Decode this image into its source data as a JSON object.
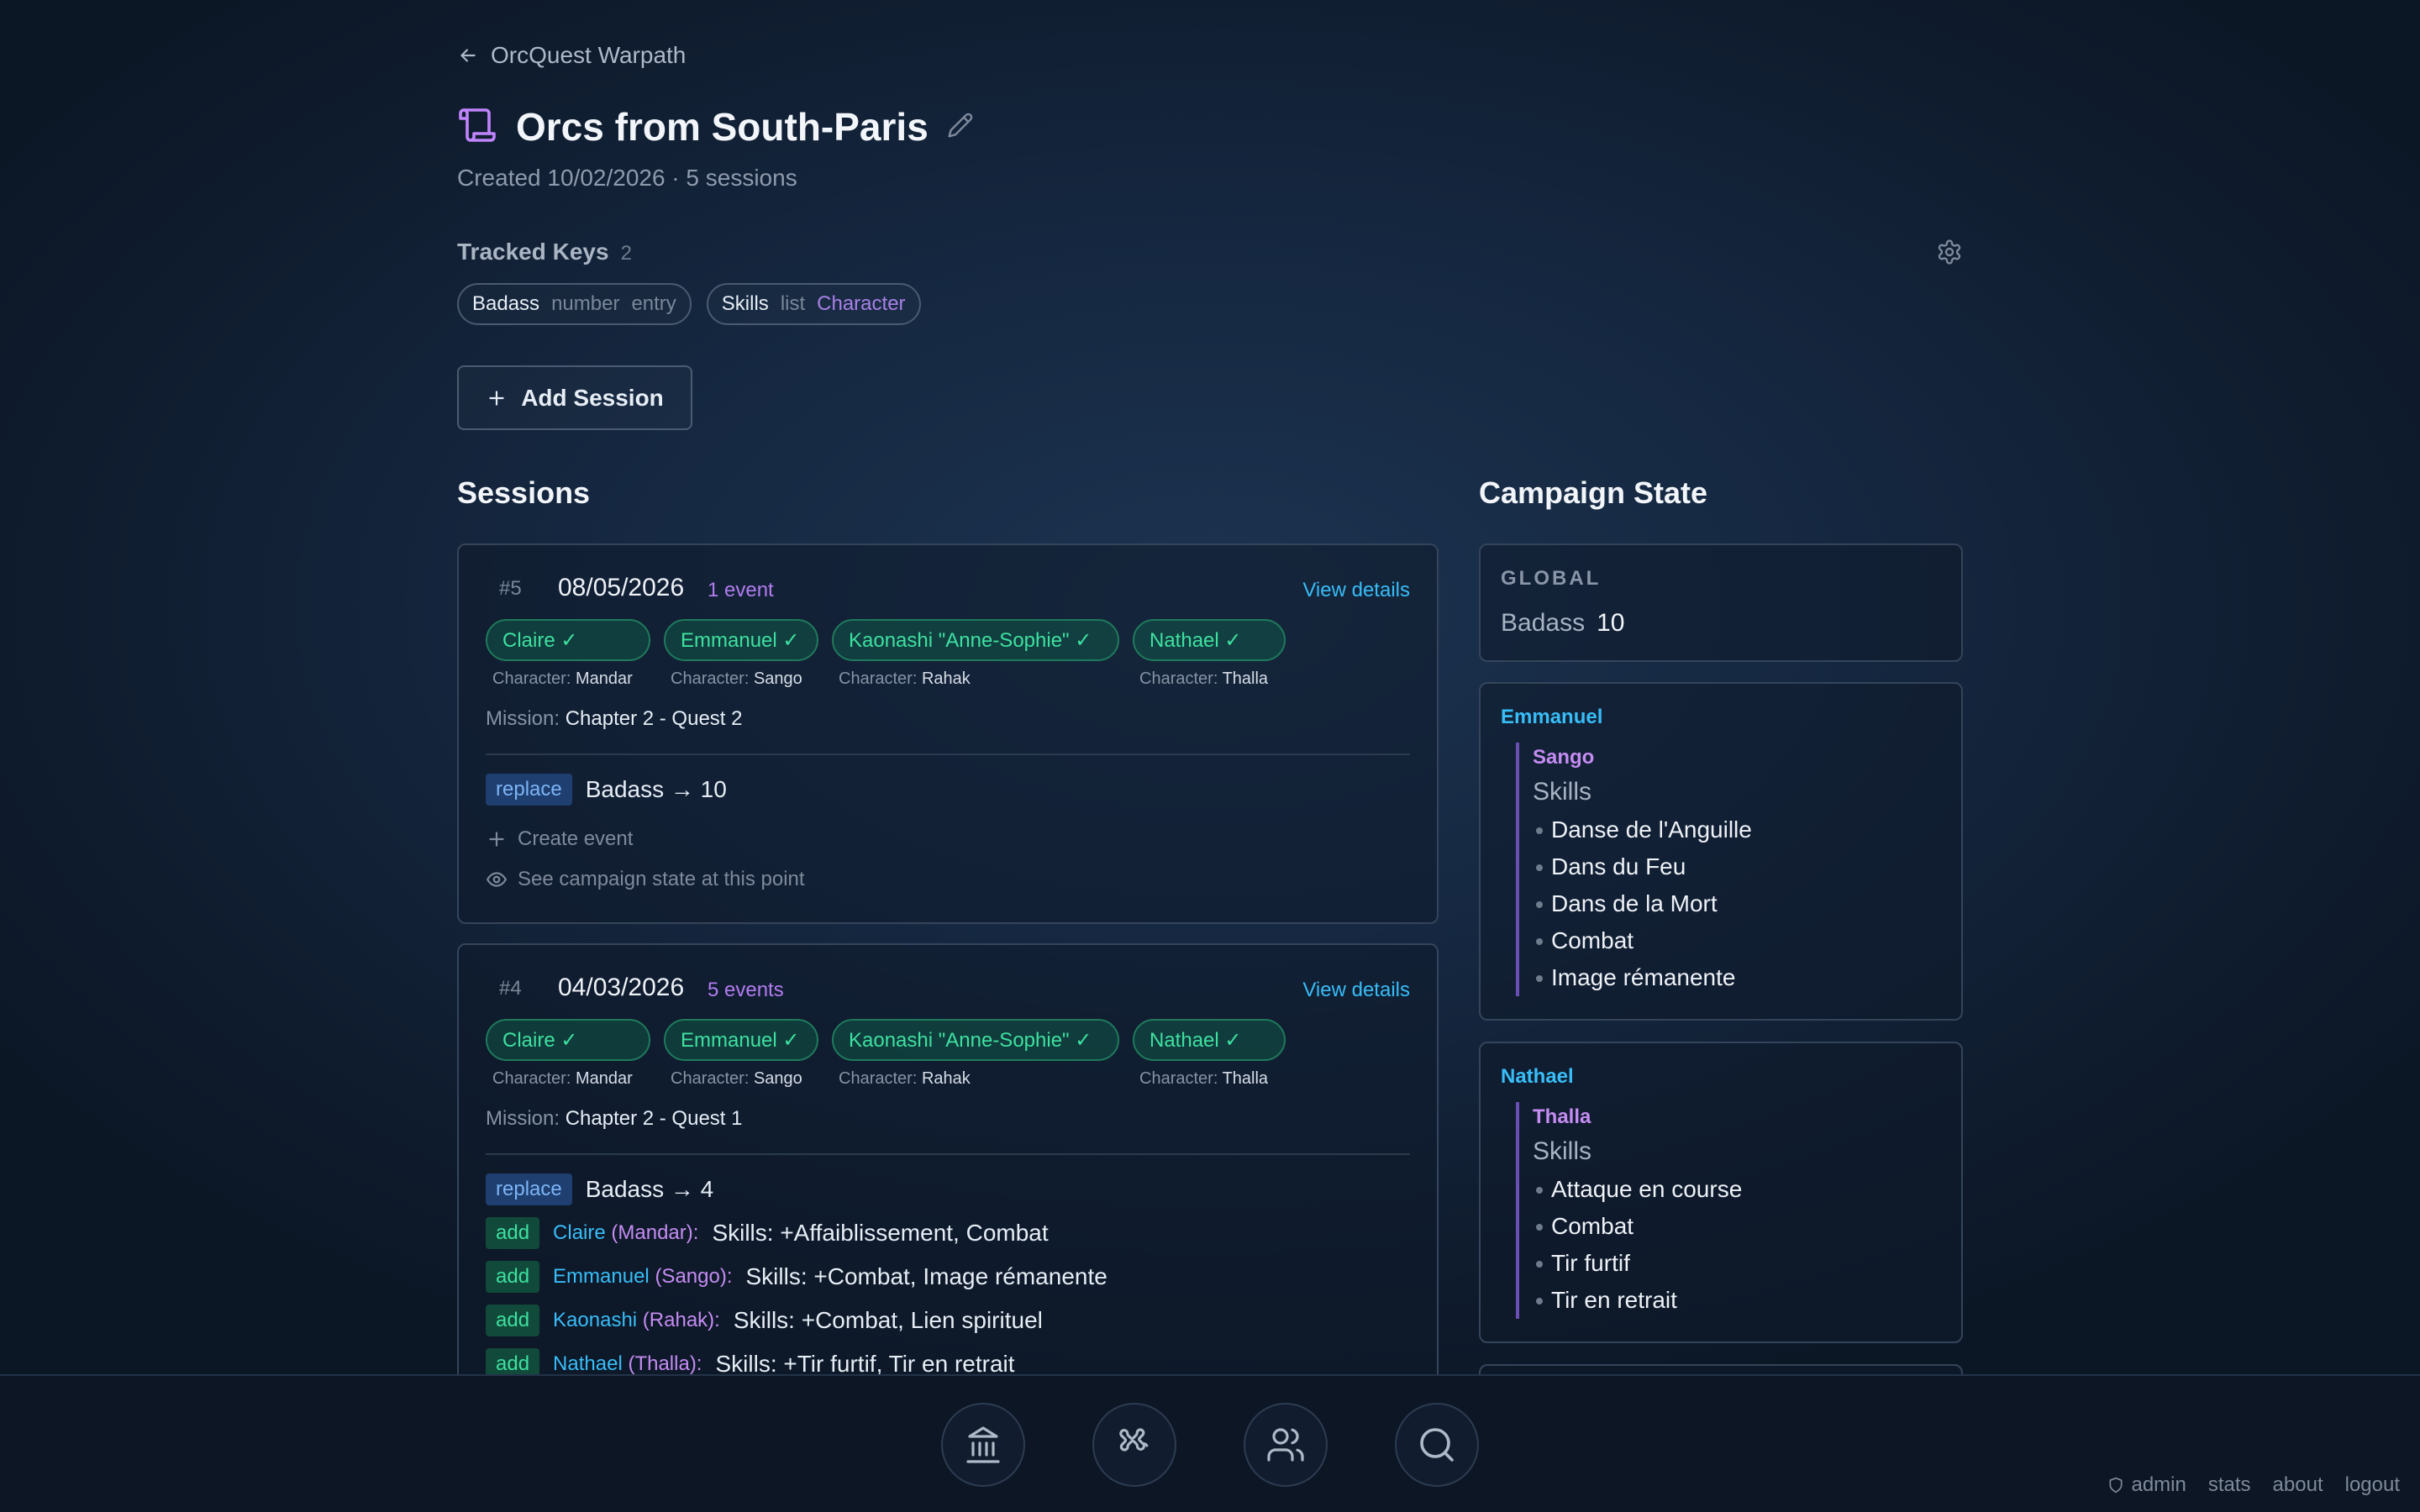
{
  "nav": {
    "back_label": "OrcQuest Warpath"
  },
  "campaign": {
    "title": "Orcs from South-Paris",
    "meta": "Created 10/02/2026 · 5 sessions"
  },
  "tracked": {
    "label": "Tracked Keys",
    "count": "2",
    "keys": [
      {
        "name": "Badass",
        "type": "number",
        "scope": "entry"
      },
      {
        "name": "Skills",
        "type": "list",
        "scope": "Character"
      }
    ]
  },
  "add_session_label": "Add Session",
  "sessions_heading": "Sessions",
  "state_heading": "Campaign State",
  "sessions": [
    {
      "num": "#5",
      "date": "08/05/2026",
      "events_label": "1 event",
      "details_label": "View details",
      "participants": [
        {
          "name": "Claire ✓",
          "character": "Mandar"
        },
        {
          "name": "Emmanuel ✓",
          "character": "Sango"
        },
        {
          "name": "Kaonashi \"Anne-Sophie\" ✓",
          "character": "Rahak"
        },
        {
          "name": "Nathael ✓",
          "character": "Thalla"
        }
      ],
      "character_label": "Character:",
      "mission_label": "Mission:",
      "mission": "Chapter 2 - Quest 2",
      "events": [
        {
          "kind": "replace",
          "text": "Badass → 10"
        }
      ],
      "create_event_label": "Create event",
      "see_state_label": "See campaign state at this point"
    },
    {
      "num": "#4",
      "date": "04/03/2026",
      "events_label": "5 events",
      "details_label": "View details",
      "participants": [
        {
          "name": "Claire ✓",
          "character": "Mandar"
        },
        {
          "name": "Emmanuel ✓",
          "character": "Sango"
        },
        {
          "name": "Kaonashi \"Anne-Sophie\" ✓",
          "character": "Rahak"
        },
        {
          "name": "Nathael ✓",
          "character": "Thalla"
        }
      ],
      "character_label": "Character:",
      "mission_label": "Mission:",
      "mission": "Chapter 2 - Quest 1",
      "events": [
        {
          "kind": "replace",
          "text": "Badass → 4"
        },
        {
          "kind": "add",
          "player": "Claire",
          "character": "(Mandar):",
          "text": "Skills: +Affaiblissement, Combat"
        },
        {
          "kind": "add",
          "player": "Emmanuel",
          "character": "(Sango):",
          "text": "Skills: +Combat, Image rémanente"
        },
        {
          "kind": "add",
          "player": "Kaonashi",
          "character": "(Rahak):",
          "text": "Skills: +Combat, Lien spirituel"
        },
        {
          "kind": "add",
          "player": "Nathael",
          "character": "(Thalla):",
          "text": "Skills: +Tir furtif, Tir en retrait"
        }
      ]
    }
  ],
  "state": {
    "global_label": "GLOBAL",
    "global": [
      {
        "key": "Badass",
        "value": "10"
      }
    ],
    "players": [
      {
        "name": "Emmanuel",
        "character": "Sango",
        "skills_label": "Skills",
        "skills": [
          "Danse de l'Anguille",
          "Dans du Feu",
          "Dans de la Mort",
          "Combat",
          "Image rémanente"
        ]
      },
      {
        "name": "Nathael",
        "character": "Thalla",
        "skills_label": "Skills",
        "skills": [
          "Attaque en course",
          "Combat",
          "Tir furtif",
          "Tir en retrait"
        ]
      }
    ]
  },
  "footer": {
    "admin": "admin",
    "stats": "stats",
    "about": "about",
    "logout": "logout"
  },
  "icons": [
    "arrow-left-icon",
    "scroll-icon",
    "pencil-icon",
    "gear-icon",
    "plus-icon",
    "eye-icon",
    "landmark-icon",
    "puzzle-icon",
    "users-icon",
    "search-icon",
    "shield-icon"
  ],
  "colors": {
    "accent_cyan": "#38bdf8",
    "accent_purple": "#b27cf0",
    "accent_green": "#3ee0a0",
    "replace_blue": "#7db4f5"
  }
}
